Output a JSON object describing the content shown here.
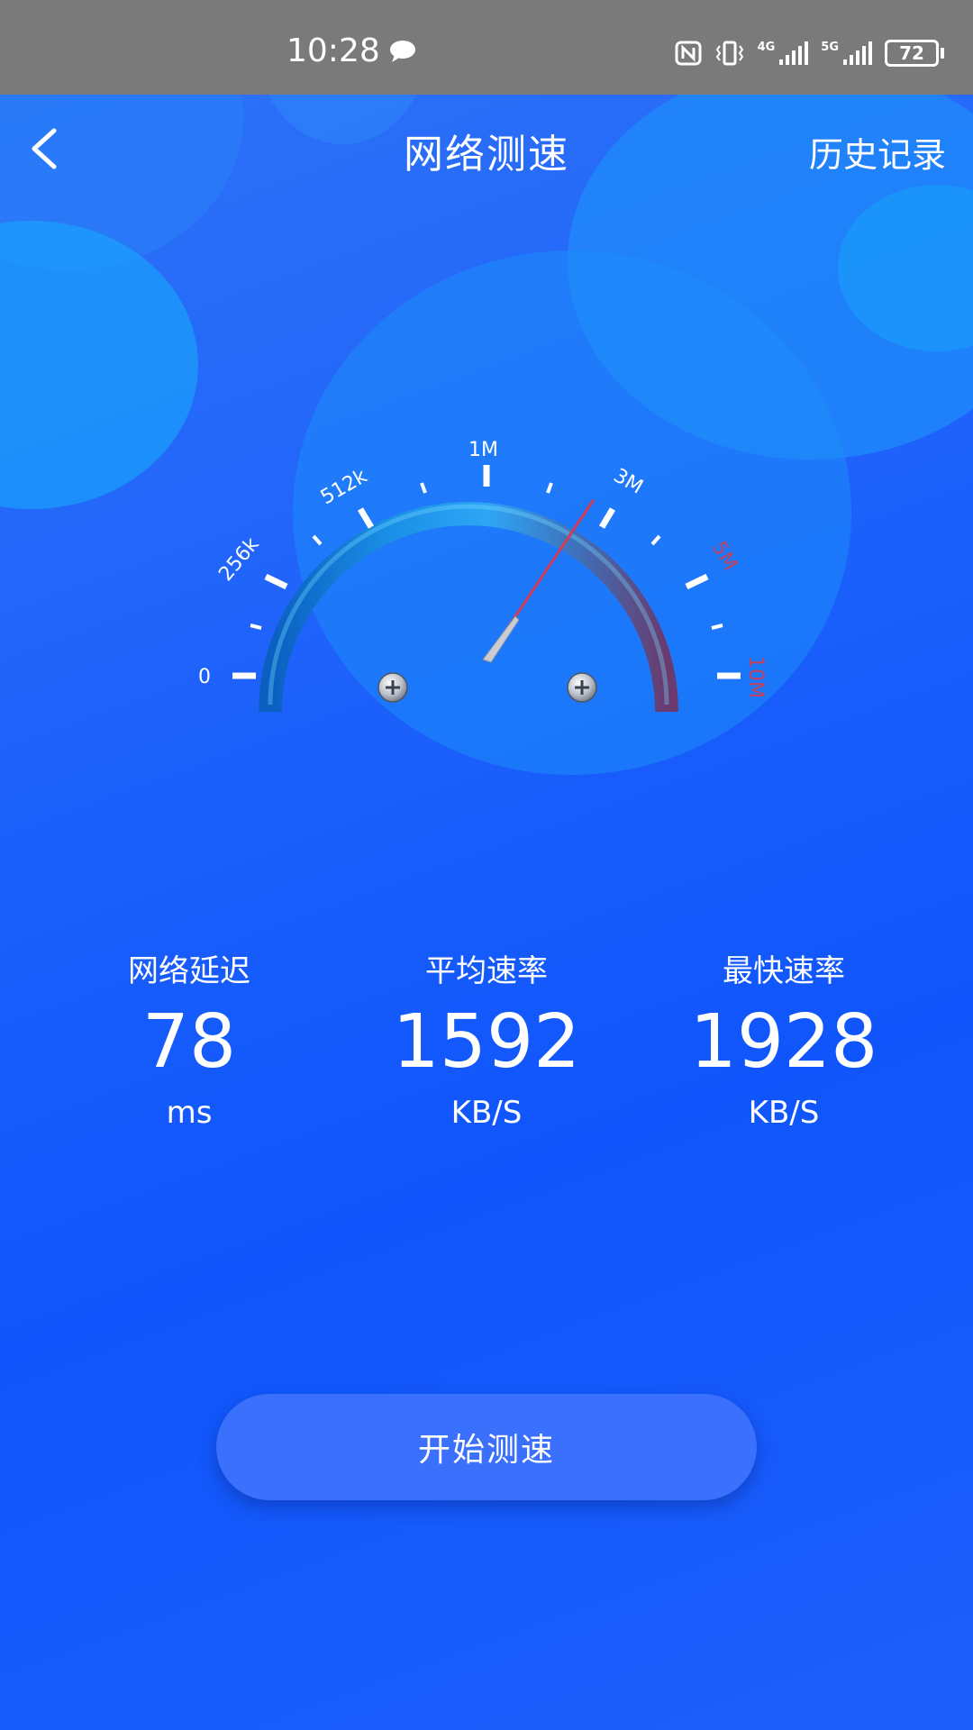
{
  "status_bar": {
    "time": "10:28",
    "battery": "72",
    "network_1": "4G",
    "network_2": "5G",
    "icons": [
      "chat-bubble-icon",
      "nfc-icon",
      "vibrate-icon",
      "signal-4g-icon",
      "signal-5g-icon",
      "battery-icon"
    ]
  },
  "header": {
    "back_icon": "chevron-left-icon",
    "title": "网络测速",
    "history_label": "历史记录"
  },
  "gauge": {
    "tick_labels": [
      "0",
      "256k",
      "512k",
      "1M",
      "3M",
      "5M",
      "10M"
    ],
    "needle_value": "3M",
    "arc_colors": [
      "#0b6fd0",
      "#2ea6f5",
      "#6a3b6e"
    ],
    "needle_color": "#d23a55"
  },
  "stats": {
    "latency": {
      "label": "网络延迟",
      "value": "78",
      "unit": "ms"
    },
    "average": {
      "label": "平均速率",
      "value": "1592",
      "unit": "KB/S"
    },
    "fastest": {
      "label": "最快速率",
      "value": "1928",
      "unit": "KB/S"
    }
  },
  "start_button": {
    "label": "开始测速"
  },
  "colors": {
    "background": "#1f63fb",
    "status_bar": "#7a7a7a",
    "button": "#3a70fb"
  }
}
